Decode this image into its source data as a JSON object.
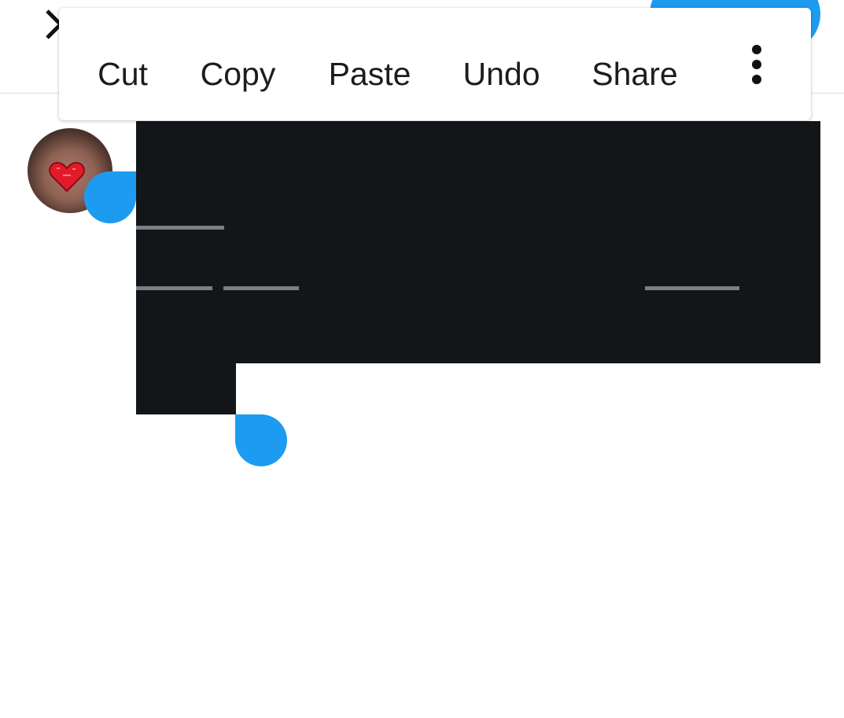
{
  "selection_toolbar": {
    "items": [
      {
        "label": "Cut"
      },
      {
        "label": "Copy"
      },
      {
        "label": "Paste"
      },
      {
        "label": "Undo"
      },
      {
        "label": "Share"
      }
    ],
    "more_icon": "more-vertical-icon"
  },
  "header": {
    "close_icon": "close-icon"
  },
  "colors": {
    "accent": "#1d9bf0",
    "selection_background": "#121619",
    "selection_text": "#7b7f84",
    "divider": "#dfe3e6"
  }
}
